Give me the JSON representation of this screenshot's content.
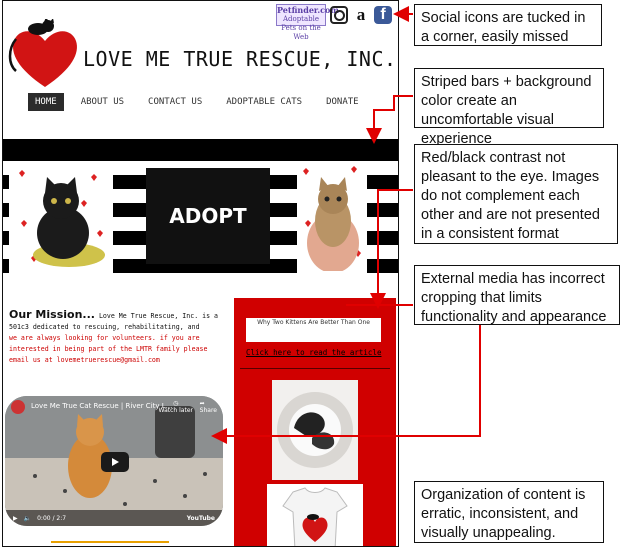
{
  "site": {
    "title": "LOVE ME TRUE RESCUE, INC.",
    "nav": [
      "HOME",
      "ABOUT US",
      "CONTACT US",
      "ADOPTABLE CATS",
      "DONATE"
    ],
    "petfinder_name": "Petfinder.com",
    "petfinder_tag": "Adoptable Pets on the Web",
    "adopt_text": "ADOPT",
    "mission_title": "Our Mission...",
    "mission_text_black": "Love Me True Rescue, Inc. is a 501c3 dedicated to rescuing, rehabilitating, and",
    "mission_text_red": "we are always looking for volunteers. if you are interested in being part of the LMTR family please email us at lovemetruerescue@gmail.com",
    "article_title": "Why Two Kittens Are Better Than One",
    "article_link": "Click here to read the article",
    "video_title": "Love Me True Cat Rescue | River City L...",
    "video_watch_later": "Watch later",
    "video_share": "Share",
    "video_time": "0:00 / 2:7",
    "video_brand": "YouTube"
  },
  "callouts": [
    "Social icons are tucked in a corner, easily missed",
    "Striped bars + background color create an uncomfortable visual experience",
    "Red/black contrast not pleasant to the eye. Images do not complement each other and are not presented in a consistent format",
    "External media has incorrect cropping that limits functionality and appearance",
    "Organization of content is erratic, inconsistent, and visually unappealing."
  ],
  "colors": {
    "accent_red": "#d00000",
    "arrow_red": "#e00000",
    "facebook_blue": "#3b5998"
  },
  "icons": [
    "instagram-icon",
    "amazon-icon",
    "facebook-icon",
    "play-icon",
    "paw-icon",
    "heart-logo-icon"
  ]
}
